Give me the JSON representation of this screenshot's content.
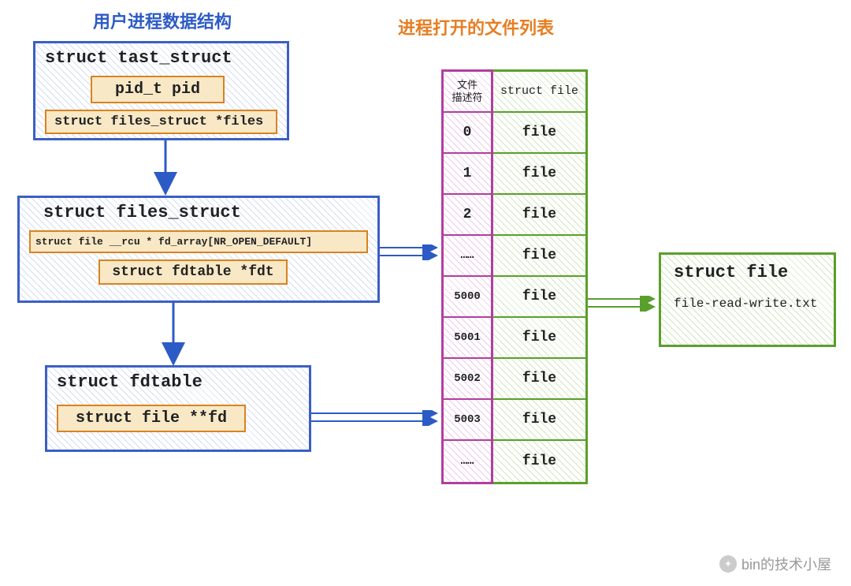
{
  "titles": {
    "left": "用户进程数据结构",
    "right": "进程打开的文件列表"
  },
  "box1": {
    "name": "struct   tast_struct",
    "field1": "pid_t   pid",
    "field2": "struct   files_struct *files"
  },
  "box2": {
    "name": "struct files_struct",
    "field1": "struct file __rcu * fd_array[NR_OPEN_DEFAULT]",
    "field2": "struct fdtable *fdt"
  },
  "box3": {
    "name": "struct fdtable",
    "field1": "struct file **fd"
  },
  "table": {
    "fd_header": "文件\n描述符",
    "file_header": "struct file",
    "rows": [
      {
        "fd": "0",
        "file": "file"
      },
      {
        "fd": "1",
        "file": "file"
      },
      {
        "fd": "2",
        "file": "file"
      },
      {
        "fd": "……",
        "file": "file"
      },
      {
        "fd": "5000",
        "file": "file"
      },
      {
        "fd": "5001",
        "file": "file"
      },
      {
        "fd": "5002",
        "file": "file"
      },
      {
        "fd": "5003",
        "file": "file"
      },
      {
        "fd": "……",
        "file": "file"
      }
    ]
  },
  "file_box": {
    "title": "struct file",
    "filename": "file-read-write.txt"
  },
  "watermark": "bin的技术小屋"
}
